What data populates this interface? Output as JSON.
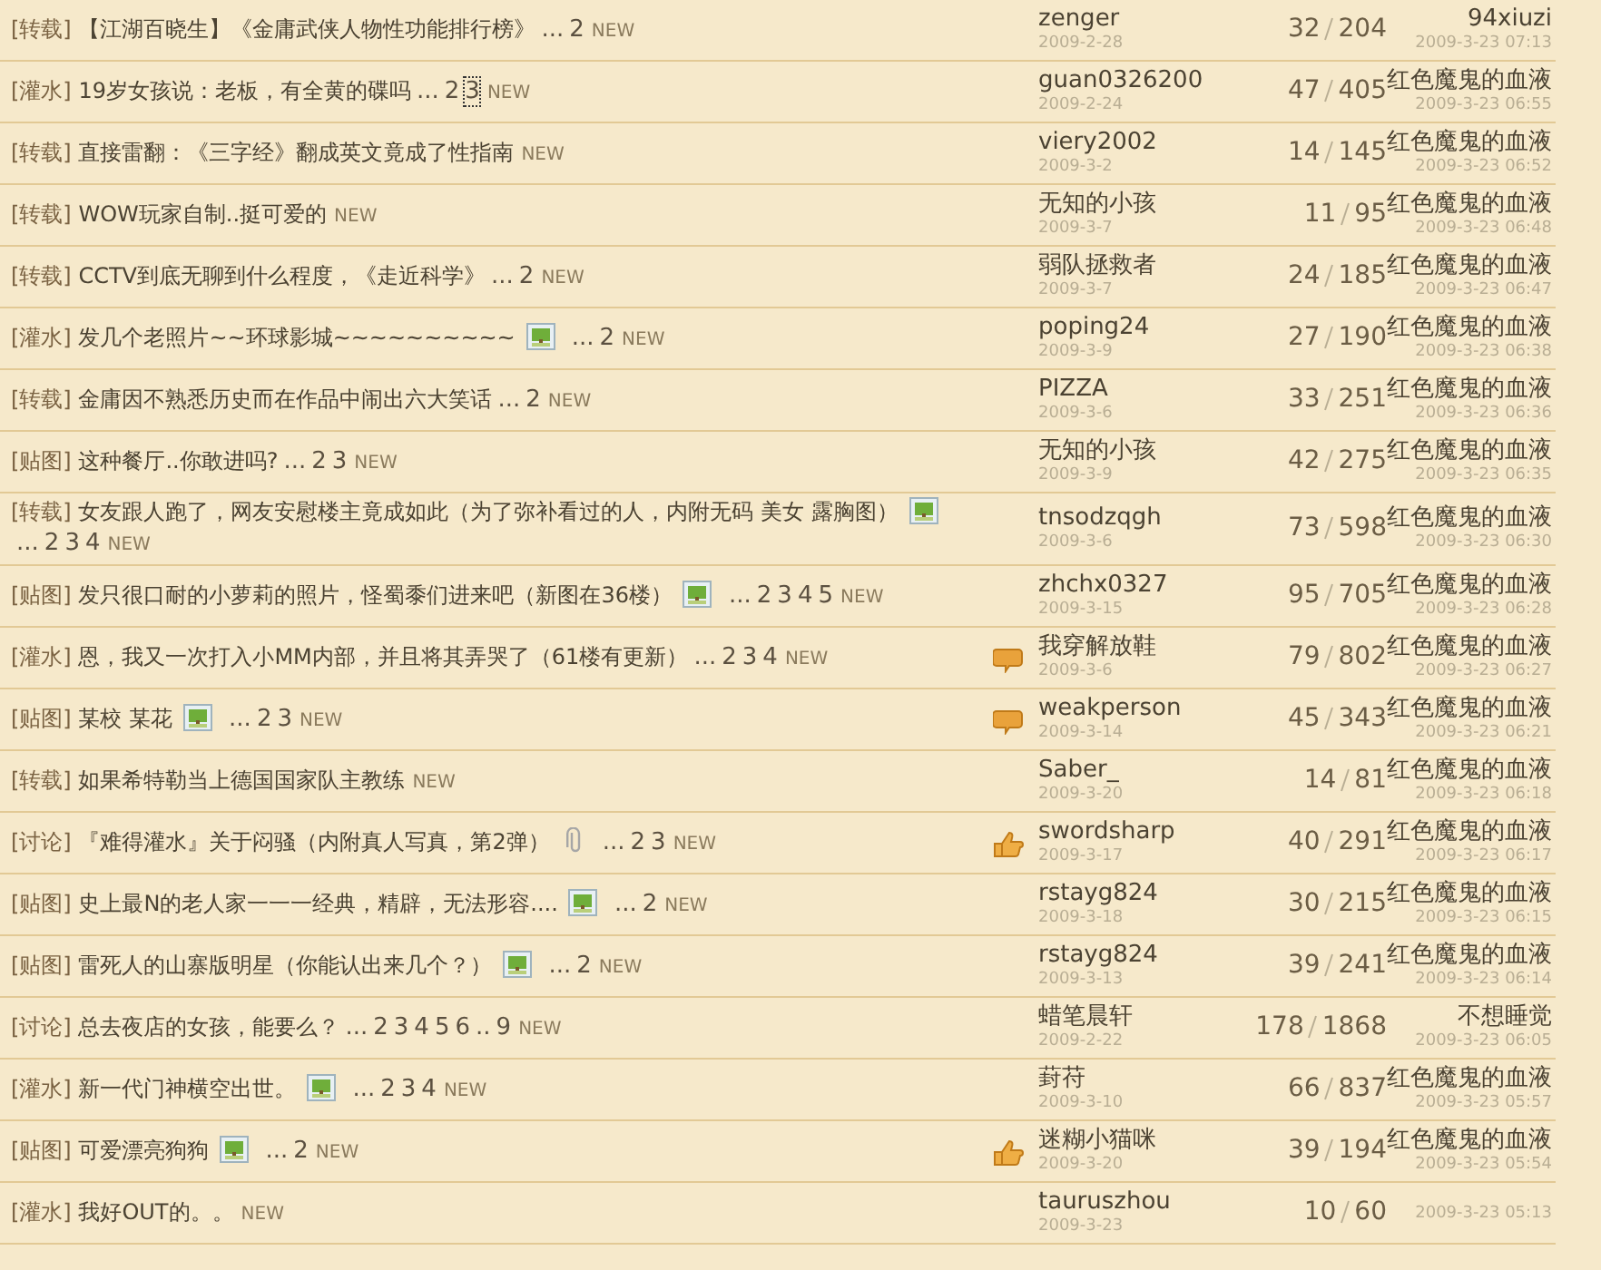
{
  "threads": [
    {
      "category": "[转载]",
      "title": "【江湖百晓生】《金庸武侠人物性功能排行榜》",
      "pages": [
        {
          "kind": "gap",
          "text": "..."
        },
        {
          "kind": "page",
          "text": "2"
        }
      ],
      "new": "NEW",
      "author": "zenger",
      "date": "2009-2-28",
      "replies": "32",
      "views": "204",
      "last_poster": "94xiuzi",
      "last_time": "2009-3-23 07:13"
    },
    {
      "category": "[灌水]",
      "title": "19岁女孩说：老板，有全黄的碟吗",
      "pages": [
        {
          "kind": "gap",
          "text": "..."
        },
        {
          "kind": "page",
          "text": "2"
        },
        {
          "kind": "page",
          "text": "3",
          "focused": true
        }
      ],
      "new": "NEW",
      "author": "guan0326200",
      "date": "2009-2-24",
      "replies": "47",
      "views": "405",
      "last_poster": "红色魔鬼的血液",
      "last_time": "2009-3-23 06:55"
    },
    {
      "category": "[转载]",
      "title": "直接雷翻：《三字经》翻成英文竟成了性指南",
      "new": "NEW",
      "author": "viery2002",
      "date": "2009-3-2",
      "replies": "14",
      "views": "145",
      "last_poster": "红色魔鬼的血液",
      "last_time": "2009-3-23 06:52"
    },
    {
      "category": "[转载]",
      "title": "WOW玩家自制..挺可爱的",
      "new": "NEW",
      "author": "无知的小孩",
      "date": "2009-3-7",
      "replies": "11",
      "views": "95",
      "last_poster": "红色魔鬼的血液",
      "last_time": "2009-3-23 06:48"
    },
    {
      "category": "[转载]",
      "title": "CCTV到底无聊到什么程度，《走近科学》",
      "pages": [
        {
          "kind": "gap",
          "text": "..."
        },
        {
          "kind": "page",
          "text": "2"
        }
      ],
      "new": "NEW",
      "author": "弱队拯救者",
      "date": "2009-3-7",
      "replies": "24",
      "views": "185",
      "last_poster": "红色魔鬼的血液",
      "last_time": "2009-3-23 06:47"
    },
    {
      "category": "[灌水]",
      "title": "发几个老照片~~环球影城~~~~~~~~~~",
      "image": true,
      "pages": [
        {
          "kind": "gap",
          "text": "..."
        },
        {
          "kind": "page",
          "text": "2"
        }
      ],
      "new": "NEW",
      "author": "poping24",
      "date": "2009-3-9",
      "replies": "27",
      "views": "190",
      "last_poster": "红色魔鬼的血液",
      "last_time": "2009-3-23 06:38"
    },
    {
      "category": "[转载]",
      "title": "金庸因不熟悉历史而在作品中闹出六大笑话",
      "pages": [
        {
          "kind": "gap",
          "text": "..."
        },
        {
          "kind": "page",
          "text": "2"
        }
      ],
      "new": "NEW",
      "author": "PIZZA",
      "date": "2009-3-6",
      "replies": "33",
      "views": "251",
      "last_poster": "红色魔鬼的血液",
      "last_time": "2009-3-23 06:36"
    },
    {
      "category": "[贴图]",
      "title": "这种餐厅..你敢进吗?",
      "pages": [
        {
          "kind": "gap",
          "text": "..."
        },
        {
          "kind": "page",
          "text": "2"
        },
        {
          "kind": "page",
          "text": "3"
        }
      ],
      "new": "NEW",
      "author": "无知的小孩",
      "date": "2009-3-9",
      "replies": "42",
      "views": "275",
      "last_poster": "红色魔鬼的血液",
      "last_time": "2009-3-23 06:35"
    },
    {
      "category": "[转载]",
      "title": "女友跟人跑了，网友安慰楼主竟成如此（为了弥补看过的人，内附无码 美女 露胸图）",
      "image": true,
      "pages": [
        {
          "kind": "gap",
          "text": "..."
        },
        {
          "kind": "page",
          "text": "2"
        },
        {
          "kind": "page",
          "text": "3"
        },
        {
          "kind": "page",
          "text": "4"
        }
      ],
      "new": "NEW",
      "author": "tnsodzqgh",
      "date": "2009-3-6",
      "replies": "73",
      "views": "598",
      "last_poster": "红色魔鬼的血液",
      "last_time": "2009-3-23 06:30"
    },
    {
      "category": "[贴图]",
      "title": "发只很口耐的小萝莉的照片，怪蜀黍们进来吧（新图在36楼）",
      "image": true,
      "pages": [
        {
          "kind": "gap",
          "text": "..."
        },
        {
          "kind": "page",
          "text": "2"
        },
        {
          "kind": "page",
          "text": "3"
        },
        {
          "kind": "page",
          "text": "4"
        },
        {
          "kind": "page",
          "text": "5"
        }
      ],
      "new": "NEW",
      "author": "zhchx0327",
      "date": "2009-3-15",
      "replies": "95",
      "views": "705",
      "last_poster": "红色魔鬼的血液",
      "last_time": "2009-3-23 06:28"
    },
    {
      "category": "[灌水]",
      "title": "恩，我又一次打入小MM内部，并且将其弄哭了（61楼有更新）",
      "pages": [
        {
          "kind": "gap",
          "text": "..."
        },
        {
          "kind": "page",
          "text": "2"
        },
        {
          "kind": "page",
          "text": "3"
        },
        {
          "kind": "page",
          "text": "4"
        }
      ],
      "new": "NEW",
      "speech_bubble": true,
      "author": "我穿解放鞋",
      "date": "2009-3-6",
      "replies": "79",
      "views": "802",
      "last_poster": "红色魔鬼的血液",
      "last_time": "2009-3-23 06:27"
    },
    {
      "category": "[贴图]",
      "title": "某校  某花",
      "image": true,
      "pages": [
        {
          "kind": "gap",
          "text": "..."
        },
        {
          "kind": "page",
          "text": "2"
        },
        {
          "kind": "page",
          "text": "3"
        }
      ],
      "new": "NEW",
      "speech_bubble": true,
      "author": "weakperson",
      "date": "2009-3-14",
      "replies": "45",
      "views": "343",
      "last_poster": "红色魔鬼的血液",
      "last_time": "2009-3-23 06:21"
    },
    {
      "category": "[转载]",
      "title": "如果希特勒当上德国国家队主教练",
      "new": "NEW",
      "author": "Saber_",
      "date": "2009-3-20",
      "replies": "14",
      "views": "81",
      "last_poster": "红色魔鬼的血液",
      "last_time": "2009-3-23 06:18"
    },
    {
      "category": "[讨论]",
      "title": "『难得灌水』关于闷骚（内附真人写真，第2弹）",
      "attachment": true,
      "pages": [
        {
          "kind": "gap",
          "text": "..."
        },
        {
          "kind": "page",
          "text": "2"
        },
        {
          "kind": "page",
          "text": "3"
        }
      ],
      "new": "NEW",
      "thumbs_up": true,
      "author": "swordsharp",
      "date": "2009-3-17",
      "replies": "40",
      "views": "291",
      "last_poster": "红色魔鬼的血液",
      "last_time": "2009-3-23 06:17"
    },
    {
      "category": "[贴图]",
      "title": "史上最N的老人家一一一经典，精辟，无法形容....",
      "image": true,
      "pages": [
        {
          "kind": "gap",
          "text": "..."
        },
        {
          "kind": "page",
          "text": "2"
        }
      ],
      "new": "NEW",
      "author": "rstayg824",
      "date": "2009-3-18",
      "replies": "30",
      "views": "215",
      "last_poster": "红色魔鬼的血液",
      "last_time": "2009-3-23 06:15"
    },
    {
      "category": "[贴图]",
      "title": "雷死人的山寨版明星（你能认出来几个？）",
      "image": true,
      "pages": [
        {
          "kind": "gap",
          "text": "..."
        },
        {
          "kind": "page",
          "text": "2"
        }
      ],
      "new": "NEW",
      "author": "rstayg824",
      "date": "2009-3-13",
      "replies": "39",
      "views": "241",
      "last_poster": "红色魔鬼的血液",
      "last_time": "2009-3-23 06:14"
    },
    {
      "category": "[讨论]",
      "title": "总去夜店的女孩，能要么？",
      "pages": [
        {
          "kind": "gap",
          "text": "..."
        },
        {
          "kind": "page",
          "text": "2"
        },
        {
          "kind": "page",
          "text": "3"
        },
        {
          "kind": "page",
          "text": "4"
        },
        {
          "kind": "page",
          "text": "5"
        },
        {
          "kind": "page",
          "text": "6"
        },
        {
          "kind": "gap",
          "text": ".."
        },
        {
          "kind": "page",
          "text": "9"
        }
      ],
      "new": "NEW",
      "author": "蜡笔晨轩",
      "date": "2009-2-22",
      "replies": "178",
      "views": "1868",
      "last_poster": "不想睡觉",
      "last_time": "2009-3-23 06:05"
    },
    {
      "category": "[灌水]",
      "title": "新一代门神横空出世。",
      "image": true,
      "pages": [
        {
          "kind": "gap",
          "text": "..."
        },
        {
          "kind": "page",
          "text": "2"
        },
        {
          "kind": "page",
          "text": "3"
        },
        {
          "kind": "page",
          "text": "4"
        }
      ],
      "new": "NEW",
      "author": "葑苻",
      "date": "2009-3-10",
      "replies": "66",
      "views": "837",
      "last_poster": "红色魔鬼的血液",
      "last_time": "2009-3-23 05:57"
    },
    {
      "category": "[贴图]",
      "title": "可爱漂亮狗狗",
      "image": true,
      "pages": [
        {
          "kind": "gap",
          "text": "..."
        },
        {
          "kind": "page",
          "text": "2"
        }
      ],
      "new": "NEW",
      "thumbs_up": true,
      "author": "迷糊小猫咪",
      "date": "2009-3-20",
      "replies": "39",
      "views": "194",
      "last_poster": "红色魔鬼的血液",
      "last_time": "2009-3-23 05:54"
    },
    {
      "category": "[灌水]",
      "title": "我好OUT的。。",
      "new": "NEW",
      "author": "tauruszhou",
      "date": "2009-3-23",
      "replies": "10",
      "views": "60",
      "last_time": "2009-3-23 05:13"
    }
  ]
}
